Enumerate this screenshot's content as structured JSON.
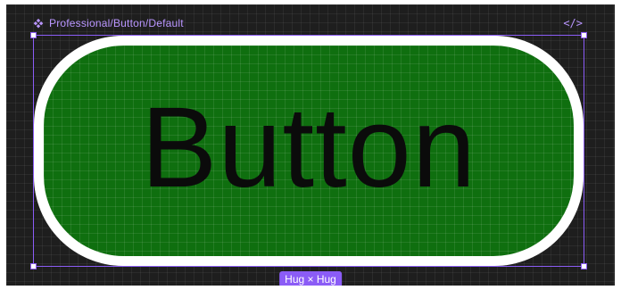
{
  "canvas": {
    "frame_path": "Professional/Button/Default",
    "component_icon": "component-icon",
    "code_icon_label": "</>",
    "code_icon": "code-icon"
  },
  "component": {
    "label": "Button",
    "fill_color": "#0f6f0f",
    "stroke_color": "#ffffff",
    "text_color": "#0b0b0b"
  },
  "selection": {
    "accent_color": "#8b5cf6",
    "size_badge": "Hug × Hug"
  }
}
